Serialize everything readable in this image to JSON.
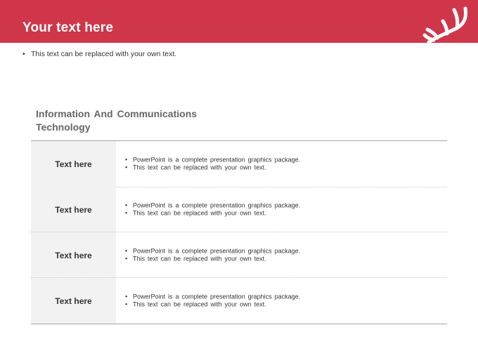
{
  "header": {
    "title": "Your text here",
    "background": "#cf3649",
    "icon": "antler-icon"
  },
  "subtitle": {
    "bullet": "•",
    "text": "This text can be replaced with your own text."
  },
  "section": {
    "title": "Information And Communications Technology"
  },
  "table": {
    "rows": [
      {
        "label": "Text here",
        "lines": [
          "PowerPoint is a complete presentation graphics package.",
          "This text can be replaced with your own text."
        ]
      },
      {
        "label": "Text here",
        "lines": [
          "PowerPoint is a complete presentation graphics package.",
          "This text can be replaced with your own text."
        ]
      },
      {
        "label": "Text here",
        "lines": [
          "PowerPoint is a complete presentation graphics package.",
          "This text can be replaced with your own text."
        ]
      },
      {
        "label": "Text here",
        "lines": [
          "PowerPoint is a complete presentation graphics package.",
          "This text can be replaced with your own text."
        ]
      }
    ],
    "bullet": "•"
  }
}
